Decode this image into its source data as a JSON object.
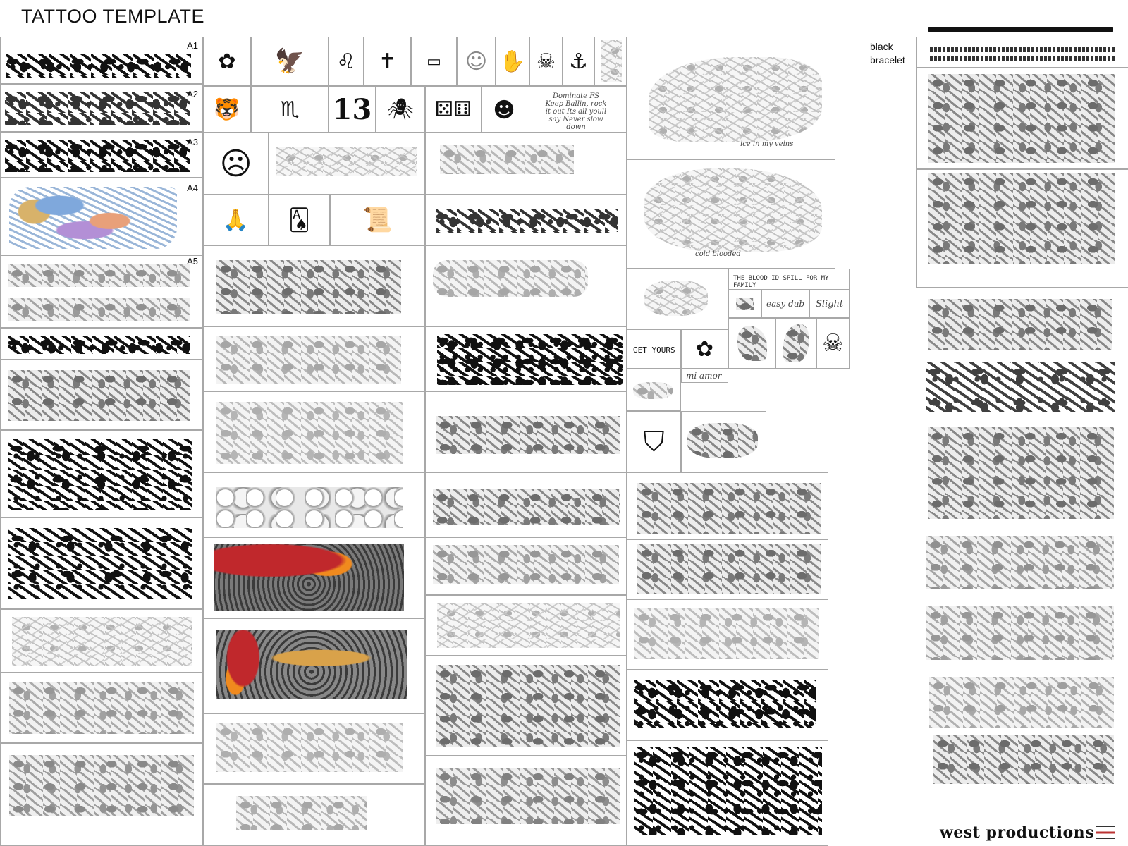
{
  "page": {
    "title": "TATTOO TEMPLATE",
    "brand": "west productions"
  },
  "labels": {
    "a1": "A1",
    "a2": "A2",
    "a3": "A3",
    "a4": "A4",
    "a5": "A5",
    "bracelet_line1": "black",
    "bracelet_line2": "bracelet"
  },
  "stickers": {
    "dominate": "Dominate FS Keep Ballin, rock it out Its all youll say Never slow down",
    "ice": "ice in my veins",
    "cold": "cold blooded",
    "family": "THE BLOOD ID SPILL FOR MY FAMILY",
    "easy_dub": "easy dub",
    "slight": "Slight",
    "get_yours": "GET YOURS",
    "mi_amor": "mi amor",
    "thirteen": "13"
  },
  "icons": [
    "rose-icon",
    "eagle-icon",
    "lion-icon",
    "virgin-mary-icon",
    "razor-blade-icon",
    "clown-icon",
    "rock-hand-icon",
    "devil-skull-icon",
    "anchor-icon",
    "tiger-icon",
    "scorpion-icon",
    "spider-icon",
    "dice-icon",
    "bald-man-icon",
    "devil-face-icon",
    "praying-hands-icon",
    "playing-cards-icon",
    "scroll-icon",
    "flower-icon",
    "skull-icon",
    "bulldog-icon",
    "california-flag-icon"
  ]
}
